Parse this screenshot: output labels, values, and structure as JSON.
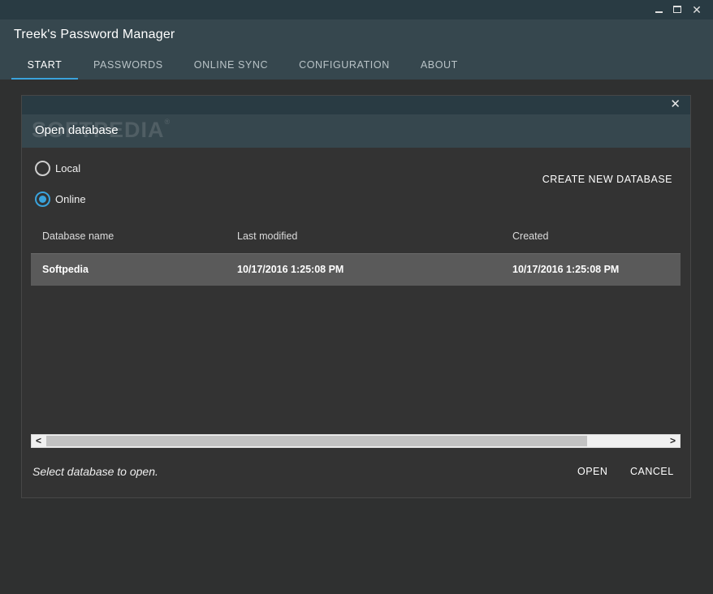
{
  "window": {
    "minimize_icon": "minimize-icon",
    "maximize_icon": "maximize-icon",
    "close_glyph": "✕"
  },
  "app": {
    "title": "Treek's Password Manager",
    "accent_color": "#3aa3dc"
  },
  "tabs": [
    {
      "label": "START",
      "active": true
    },
    {
      "label": "PASSWORDS",
      "active": false
    },
    {
      "label": "ONLINE SYNC",
      "active": false
    },
    {
      "label": "CONFIGURATION",
      "active": false
    },
    {
      "label": "ABOUT",
      "active": false
    }
  ],
  "dialog": {
    "close_glyph": "✕",
    "watermark": "SOFTPEDIA",
    "title": "Open database",
    "source": {
      "local_label": "Local",
      "online_label": "Online",
      "selected": "Online"
    },
    "create_label": "CREATE NEW DATABASE",
    "table": {
      "columns": [
        "Database name",
        "Last modified",
        "Created"
      ],
      "rows": [
        {
          "name": "Softpedia",
          "modified": "10/17/2016 1:25:08 PM",
          "created": "10/17/2016 1:25:08 PM",
          "selected": true
        }
      ]
    },
    "scroll": {
      "left_glyph": "<",
      "right_glyph": ">"
    },
    "status": "Select database to open.",
    "open_label": "OPEN",
    "cancel_label": "CANCEL"
  }
}
